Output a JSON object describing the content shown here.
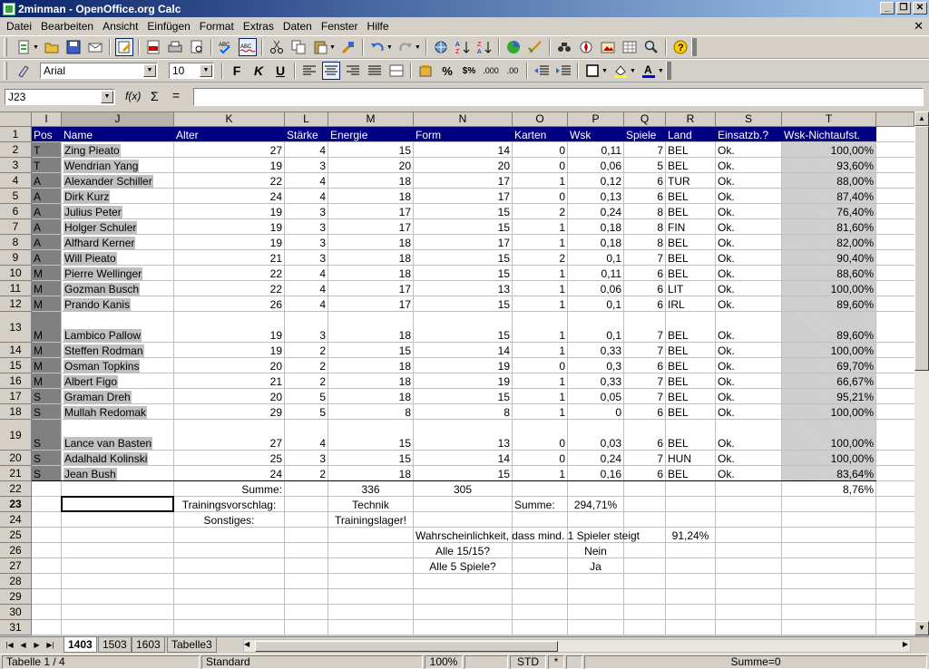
{
  "window": {
    "title": "2minman - OpenOffice.org Calc"
  },
  "menu": [
    "Datei",
    "Bearbeiten",
    "Ansicht",
    "Einfügen",
    "Format",
    "Extras",
    "Daten",
    "Fenster",
    "Hilfe"
  ],
  "format": {
    "font": "Arial",
    "size": "10"
  },
  "formula": {
    "cell_ref": "J23",
    "value": ""
  },
  "columns": [
    "I",
    "J",
    "K",
    "L",
    "M",
    "N",
    "O",
    "P",
    "Q",
    "R",
    "S",
    "T"
  ],
  "selected_column": "J",
  "selected_row": "23",
  "header_row": [
    "Pos",
    "Name",
    "Alter",
    "Stärke",
    "Energie",
    "Form",
    "Karten",
    "Wsk",
    "Spiele",
    "Land",
    "Einsatzb.?",
    "Wsk-Nichtaufst."
  ],
  "players": [
    [
      "T",
      "Zing Pieato",
      "27",
      "4",
      "15",
      "14",
      "0",
      "0,11",
      "7",
      "BEL",
      "Ok.",
      "100,00%"
    ],
    [
      "T",
      "Wendrian Yang",
      "19",
      "3",
      "20",
      "20",
      "0",
      "0,06",
      "5",
      "BEL",
      "Ok.",
      "93,60%"
    ],
    [
      "A",
      "Alexander Schiller",
      "22",
      "4",
      "18",
      "17",
      "1",
      "0,12",
      "6",
      "TUR",
      "Ok.",
      "88,00%"
    ],
    [
      "A",
      "Dirk Kurz",
      "24",
      "4",
      "18",
      "17",
      "0",
      "0,13",
      "6",
      "BEL",
      "Ok.",
      "87,40%"
    ],
    [
      "A",
      "Julius Peter",
      "19",
      "3",
      "17",
      "15",
      "2",
      "0,24",
      "8",
      "BEL",
      "Ok.",
      "76,40%"
    ],
    [
      "A",
      "Holger Schuler",
      "19",
      "3",
      "17",
      "15",
      "1",
      "0,18",
      "8",
      "FIN",
      "Ok.",
      "81,60%"
    ],
    [
      "A",
      "Alfhard Kerner",
      "19",
      "3",
      "18",
      "17",
      "1",
      "0,18",
      "8",
      "BEL",
      "Ok.",
      "82,00%"
    ],
    [
      "A",
      "Will Pieato",
      "21",
      "3",
      "18",
      "15",
      "2",
      "0,1",
      "7",
      "BEL",
      "Ok.",
      "90,40%"
    ],
    [
      "M",
      "Pierre Wellinger",
      "22",
      "4",
      "18",
      "15",
      "1",
      "0,11",
      "6",
      "BEL",
      "Ok.",
      "88,60%"
    ],
    [
      "M",
      "Gozman Busch",
      "22",
      "4",
      "17",
      "13",
      "1",
      "0,06",
      "6",
      "LIT",
      "Ok.",
      "100,00%"
    ],
    [
      "M",
      "Prando Kanis",
      "26",
      "4",
      "17",
      "15",
      "1",
      "0,1",
      "6",
      "IRL",
      "Ok.",
      "89,60%"
    ],
    [
      "M",
      "Lambico Pallow",
      "19",
      "3",
      "18",
      "15",
      "1",
      "0,1",
      "7",
      "BEL",
      "Ok.",
      "89,60%"
    ],
    [
      "M",
      "Steffen Rodman",
      "19",
      "2",
      "15",
      "14",
      "1",
      "0,33",
      "7",
      "BEL",
      "Ok.",
      "100,00%"
    ],
    [
      "M",
      "Osman Topkins",
      "20",
      "2",
      "18",
      "19",
      "0",
      "0,3",
      "6",
      "BEL",
      "Ok.",
      "69,70%"
    ],
    [
      "M",
      "Albert Figo",
      "21",
      "2",
      "18",
      "19",
      "1",
      "0,33",
      "7",
      "BEL",
      "Ok.",
      "66,67%"
    ],
    [
      "S",
      "Graman Dreh",
      "20",
      "5",
      "18",
      "15",
      "1",
      "0,05",
      "7",
      "BEL",
      "Ok.",
      "95,21%"
    ],
    [
      "S",
      "Mullah Redomak",
      "29",
      "5",
      "8",
      "8",
      "1",
      "0",
      "6",
      "BEL",
      "Ok.",
      "100,00%"
    ],
    [
      "S",
      "Lance van Basten",
      "27",
      "4",
      "15",
      "13",
      "0",
      "0,03",
      "6",
      "BEL",
      "Ok.",
      "100,00%"
    ],
    [
      "S",
      "Adalhald Kolinski",
      "25",
      "3",
      "15",
      "14",
      "0",
      "0,24",
      "7",
      "HUN",
      "Ok.",
      "100,00%"
    ],
    [
      "S",
      "Jean Bush",
      "24",
      "2",
      "18",
      "15",
      "1",
      "0,16",
      "6",
      "BEL",
      "Ok.",
      "83,64%"
    ]
  ],
  "summary": {
    "summe_label": "Summe:",
    "summe_energie": "336",
    "summe_form": "305",
    "t22": "8,76%",
    "training_label": "Trainingsvorschlag:",
    "training_value": "Technik",
    "summe2_label": "Summe:",
    "summe2_value": "294,71%",
    "sonstiges_label": "Sonstiges:",
    "sonstiges_value": "Trainingslager!",
    "wahr_label": "Wahrscheinlichkeit, dass mind. 1 Spieler steigt",
    "wahr_value": "91,24%",
    "q1_label": "Alle 15/15?",
    "q1_value": "Nein",
    "q2_label": "Alle 5 Spiele?",
    "q2_value": "Ja"
  },
  "row_numbers": [
    "1",
    "2",
    "3",
    "4",
    "5",
    "6",
    "7",
    "8",
    "9",
    "10",
    "11",
    "12",
    "13",
    "14",
    "15",
    "16",
    "17",
    "18",
    "19",
    "20",
    "21",
    "22",
    "23",
    "24",
    "25",
    "26",
    "27",
    "28",
    "29",
    "30",
    "31"
  ],
  "tabs": [
    "1403",
    "1503",
    "1603",
    "Tabelle3"
  ],
  "active_tab": "1403",
  "status": {
    "sheet": "Tabelle 1 / 4",
    "style": "Standard",
    "zoom": "100%",
    "mode": "STD",
    "modified": "*",
    "sum": "Summe=0"
  }
}
